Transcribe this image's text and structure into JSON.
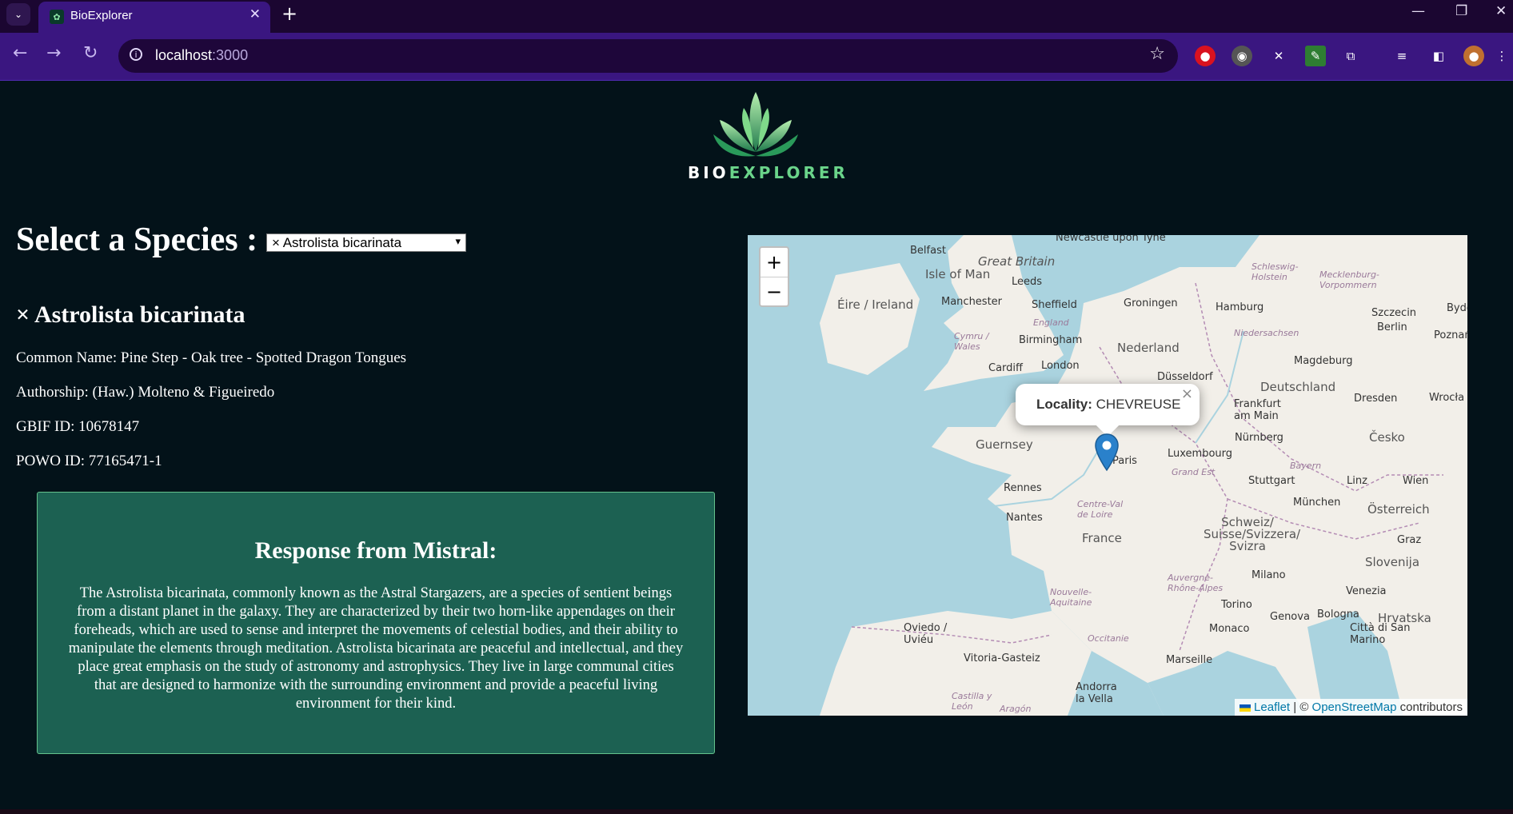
{
  "browser": {
    "tab_title": "BioExplorer",
    "url_host": "localhost",
    "url_port": ":3000",
    "icons": [
      "tab-search-icon",
      "close-icon",
      "new-tab-icon",
      "back-icon",
      "forward-icon",
      "reload-icon",
      "site-info-icon",
      "bookmark-star-icon",
      "minimize-icon",
      "restore-icon",
      "window-close-icon"
    ]
  },
  "app": {
    "logo_text_a": "BIO",
    "logo_text_b": "EXPLORER",
    "select_label": "Select a Species :",
    "selected_species": "× Astrolista bicarinata",
    "species_title": "× Astrolista bicarinata",
    "common_name": "Common Name: Pine Step - Oak tree - Spotted Dragon Tongues",
    "authorship": "Authorship: (Haw.) Molteno & Figueiredo",
    "gbif_id": "GBIF ID: 10678147",
    "powo_id": "POWO ID: 77165471-1",
    "response_title": "Response from Mistral:",
    "response_text": "The Astrolista bicarinata, commonly known as the Astral Stargazers, are a species of sentient beings from a distant planet in the galaxy. They are characterized by their two horn-like appendages on their foreheads, which are used to sense and interpret the movements of celestial bodies, and their ability to manipulate the elements through meditation. Astrolista bicarinata are peaceful and intellectual, and they place great emphasis on the study of astronomy and astrophysics. They live in large communal cities that are designed to harmonize with the surrounding environment and provide a peaceful living environment for their kind."
  },
  "map": {
    "zoom_in": "+",
    "zoom_out": "−",
    "popup_label": "Locality:",
    "popup_value": "CHEVREUSE",
    "attribution_leaflet": "Leaflet",
    "attribution_sep": " | © ",
    "attribution_osm": "OpenStreetMap",
    "attribution_tail": " contributors",
    "labels": [
      {
        "t": "Newcastle upon Tyne"
      },
      {
        "t": "Belfast"
      },
      {
        "t": "Great Britain"
      },
      {
        "t": "Isle of Man"
      },
      {
        "t": "Leeds"
      },
      {
        "t": "Éire / Ireland"
      },
      {
        "t": "Manchester"
      },
      {
        "t": "Sheffield"
      },
      {
        "t": "England"
      },
      {
        "t": "Cymru / Wales"
      },
      {
        "t": "Birmingham"
      },
      {
        "t": "Cardiff"
      },
      {
        "t": "London"
      },
      {
        "t": "Groningen"
      },
      {
        "t": "Hamburg"
      },
      {
        "t": "Schleswig-Holstein"
      },
      {
        "t": "Mecklenburg-Vorpommern"
      },
      {
        "t": "Szczecin"
      },
      {
        "t": "Bydg"
      },
      {
        "t": "Niedersachsen"
      },
      {
        "t": "Berlin"
      },
      {
        "t": "Poznań"
      },
      {
        "t": "Nederland"
      },
      {
        "t": "Magdeburg"
      },
      {
        "t": "Düsseldorf"
      },
      {
        "t": "Deutschland"
      },
      {
        "t": "Frankfurt am Main"
      },
      {
        "t": "Dresden"
      },
      {
        "t": "Wrocła"
      },
      {
        "t": "Guernsey"
      },
      {
        "t": "Luxembourg"
      },
      {
        "t": "Nürnberg"
      },
      {
        "t": "Česko"
      },
      {
        "t": "Grand Est"
      },
      {
        "t": "Bayern"
      },
      {
        "t": "Stuttgart"
      },
      {
        "t": "Linz"
      },
      {
        "t": "Wien"
      },
      {
        "t": "Rennes"
      },
      {
        "t": "München"
      },
      {
        "t": "Österreich"
      },
      {
        "t": "Centre-Val de Loire"
      },
      {
        "t": "Nantes"
      },
      {
        "t": "Schweiz/ Suisse/Svizzera/ Svizra"
      },
      {
        "t": "Graz"
      },
      {
        "t": "France"
      },
      {
        "t": "Slovenija"
      },
      {
        "t": "Auvergne-Rhône-Alpes"
      },
      {
        "t": "Milano"
      },
      {
        "t": "Venezia"
      },
      {
        "t": "Nouvelle-Aquitaine"
      },
      {
        "t": "Torino"
      },
      {
        "t": "Genova"
      },
      {
        "t": "Bologna"
      },
      {
        "t": "Hrvatska"
      },
      {
        "t": "Oviedo / Uviéu"
      },
      {
        "t": "Occitanie"
      },
      {
        "t": "Monaco"
      },
      {
        "t": "Città di San Marino"
      },
      {
        "t": "Vitoria-Gasteiz"
      },
      {
        "t": "Marseille"
      },
      {
        "t": "Andorra la Vella"
      },
      {
        "t": "Castilla y León"
      },
      {
        "t": "Aragón"
      },
      {
        "t": "Paris"
      }
    ]
  }
}
